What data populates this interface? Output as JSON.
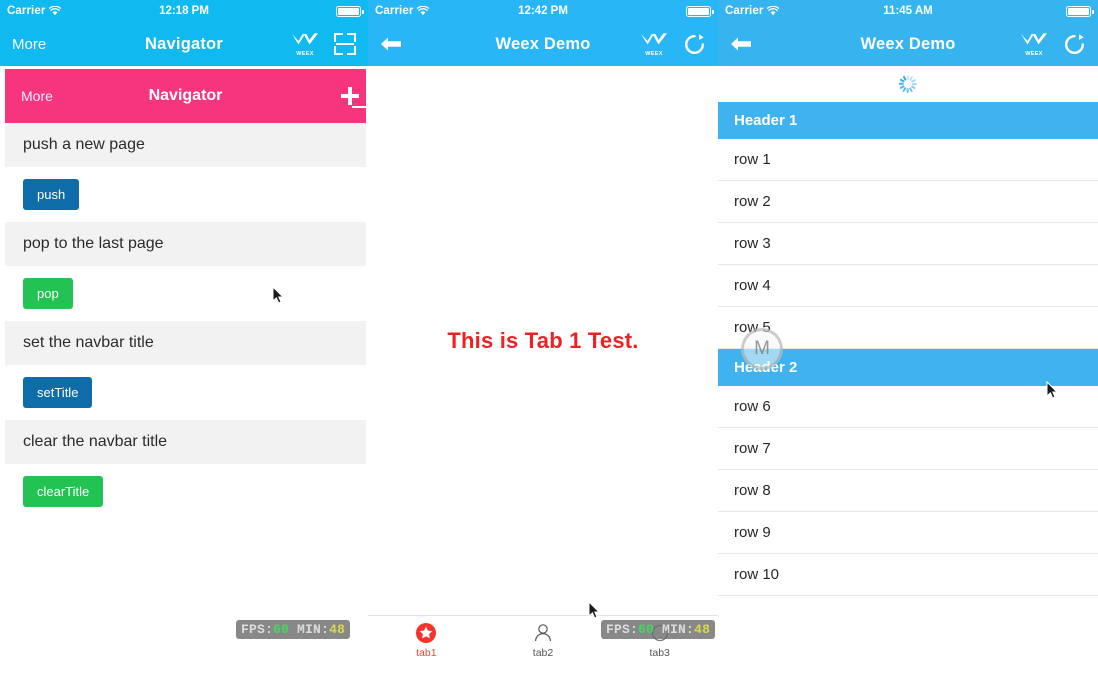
{
  "panels": {
    "left": {
      "statusbar": {
        "carrier": "Carrier",
        "time": "12:18 PM",
        "wifi_icon": "wifi-icon",
        "battery_icon": "battery-icon"
      },
      "navbar": {
        "left_label": "More",
        "title": "Navigator",
        "logo_icon": "weex-logo-icon",
        "logo_text": "WEEX",
        "scan_icon": "scan-frame-icon"
      },
      "weex_navbar": {
        "left_label": "More",
        "title": "Navigator",
        "scan_icon": "scan-frame-icon",
        "background": "#f7357f"
      },
      "sections": [
        {
          "label": "push a new page",
          "button": {
            "text": "push",
            "color": "#0e6ca8",
            "style": "blue"
          }
        },
        {
          "label": "pop to the last page",
          "button": {
            "text": "pop",
            "color": "#22c352",
            "style": "green"
          }
        },
        {
          "label": "set the navbar title",
          "button": {
            "text": "setTitle",
            "color": "#0e6ca8",
            "style": "blue"
          }
        },
        {
          "label": "clear the navbar title",
          "button": {
            "text": "clearTitle",
            "color": "#22c352",
            "style": "green"
          }
        }
      ],
      "fps": {
        "fps_label": "FPS:",
        "fps_value": "60",
        "min_label": "MIN:",
        "min_value": "48"
      }
    },
    "middle": {
      "statusbar": {
        "carrier": "Carrier",
        "time": "12:42 PM",
        "wifi_icon": "wifi-icon",
        "battery_icon": "battery-icon"
      },
      "navbar": {
        "back_icon": "back-arrow-icon",
        "title": "Weex Demo",
        "logo_icon": "weex-logo-icon",
        "logo_text": "WEEX",
        "refresh_icon": "refresh-icon"
      },
      "body_text": "This is Tab 1 Test.",
      "body_text_color": "#ee2222",
      "tabs": [
        {
          "label": "tab1",
          "icon": "star-badge-icon",
          "active": true
        },
        {
          "label": "tab2",
          "icon": "user-outline-icon",
          "active": false
        },
        {
          "label": "tab3",
          "icon": "circle-icon",
          "active": false
        }
      ],
      "fps": {
        "fps_label": "FPS:",
        "fps_value": "60",
        "min_label": "MIN:",
        "min_value": "48"
      }
    },
    "right": {
      "statusbar": {
        "carrier": "Carrier",
        "time": "11:45 AM",
        "wifi_icon": "wifi-icon",
        "battery_icon": "battery-icon"
      },
      "navbar": {
        "back_icon": "back-arrow-icon",
        "title": "Weex Demo",
        "logo_icon": "weex-logo-icon",
        "logo_text": "WEEX",
        "refresh_icon": "refresh-icon"
      },
      "loading_icon": "activity-spinner-icon",
      "list": [
        {
          "type": "header",
          "text": "Header 1"
        },
        {
          "type": "row",
          "text": "row 1"
        },
        {
          "type": "row",
          "text": "row 2"
        },
        {
          "type": "row",
          "text": "row 3"
        },
        {
          "type": "row",
          "text": "row 4"
        },
        {
          "type": "row",
          "text": "row 5"
        },
        {
          "type": "header",
          "text": "Header 2"
        },
        {
          "type": "row",
          "text": "row 6"
        },
        {
          "type": "row",
          "text": "row 7"
        },
        {
          "type": "row",
          "text": "row 8"
        },
        {
          "type": "row",
          "text": "row 9"
        },
        {
          "type": "row",
          "text": "row 10"
        }
      ],
      "floating_badge": {
        "text": "M",
        "icon": "weex-inspector-badge-icon"
      }
    }
  },
  "colors": {
    "ios_blue": "#10b9ef",
    "mid_blue": "#29b6f6",
    "right_blue": "#35b4f0",
    "pink": "#f7357f",
    "list_header_blue": "#3fb3ef",
    "red_text": "#ee2222",
    "button_blue": "#0e6ca8",
    "button_green": "#22c352",
    "fps_green": "#3ddb5e",
    "fps_yellow": "#d9d94a"
  }
}
